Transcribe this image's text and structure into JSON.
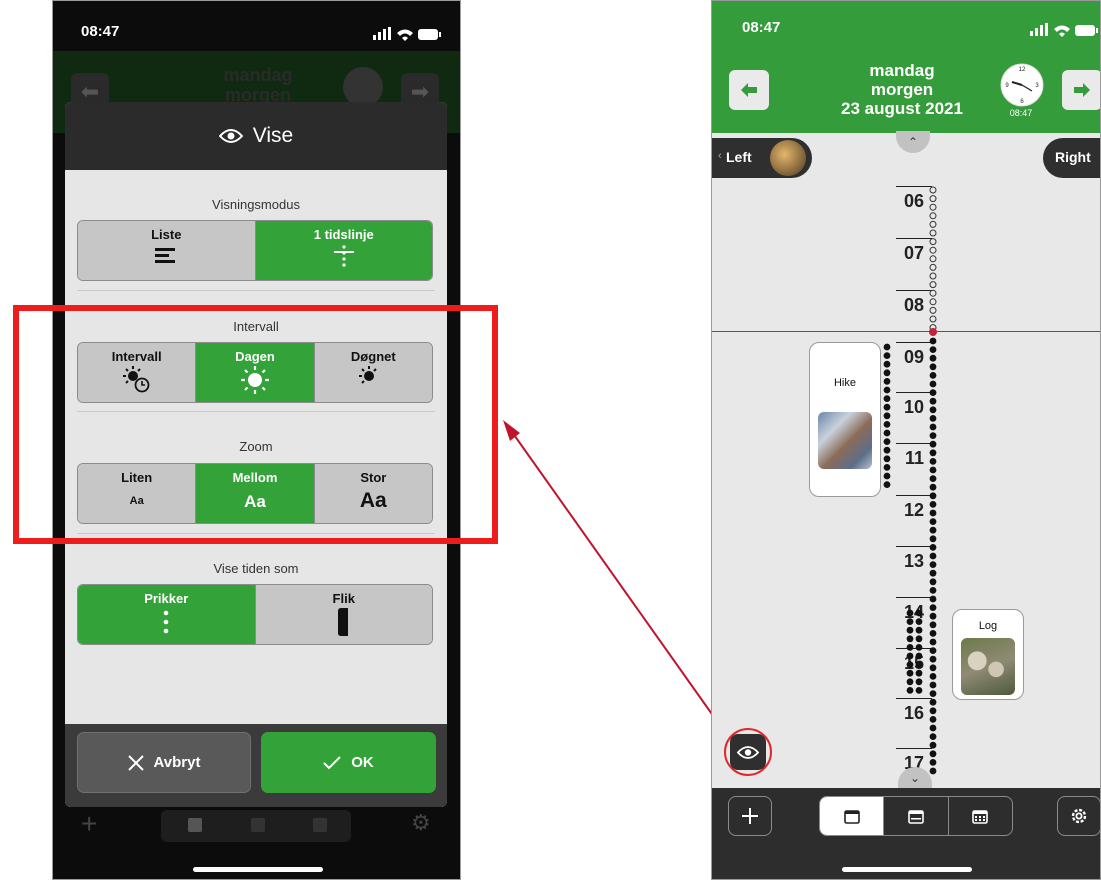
{
  "left_phone": {
    "status": {
      "time": "08:47"
    },
    "background": {
      "day": "mandag",
      "part": "morgen"
    },
    "dialog": {
      "title": "Vise",
      "sections": {
        "display_mode": {
          "title": "Visningsmodus",
          "options": [
            "Liste",
            "1 tidslinje"
          ],
          "selected": "1 tidslinje"
        },
        "interval": {
          "title": "Intervall",
          "options": [
            "Intervall",
            "Dagen",
            "Døgnet"
          ],
          "selected": "Dagen"
        },
        "zoom": {
          "title": "Zoom",
          "options": [
            "Liten",
            "Mellom",
            "Stor"
          ],
          "sample": "Aa",
          "selected": "Mellom"
        },
        "time_as": {
          "title": "Vise tiden som",
          "options": [
            "Prikker",
            "Flik"
          ],
          "selected": "Prikker"
        }
      },
      "buttons": {
        "cancel": "Avbryt",
        "ok": "OK"
      }
    }
  },
  "right_phone": {
    "status": {
      "time": "08:47"
    },
    "header": {
      "day": "mandag",
      "part": "morgen",
      "date": "23 august 2021",
      "clock_time": "08:47"
    },
    "users": {
      "left_label": "Left",
      "right_label": "Right"
    },
    "timeline": {
      "hours": [
        "06",
        "07",
        "08",
        "09",
        "10",
        "11",
        "12",
        "13",
        "14",
        "15",
        "16",
        "17"
      ],
      "current_time": "08:47"
    },
    "activities": [
      {
        "title": "Hike"
      },
      {
        "title": "Log"
      }
    ],
    "toolbar": {
      "icons": [
        "plus-icon",
        "calendar-day-icon",
        "calendar-week-icon",
        "calendar-month-icon",
        "gear-icon"
      ]
    }
  },
  "colors": {
    "green": "#33a339",
    "highlight_red": "#ee1c1c",
    "arrow_red": "#c0142c",
    "dialog_bg": "#e6e6e6"
  }
}
